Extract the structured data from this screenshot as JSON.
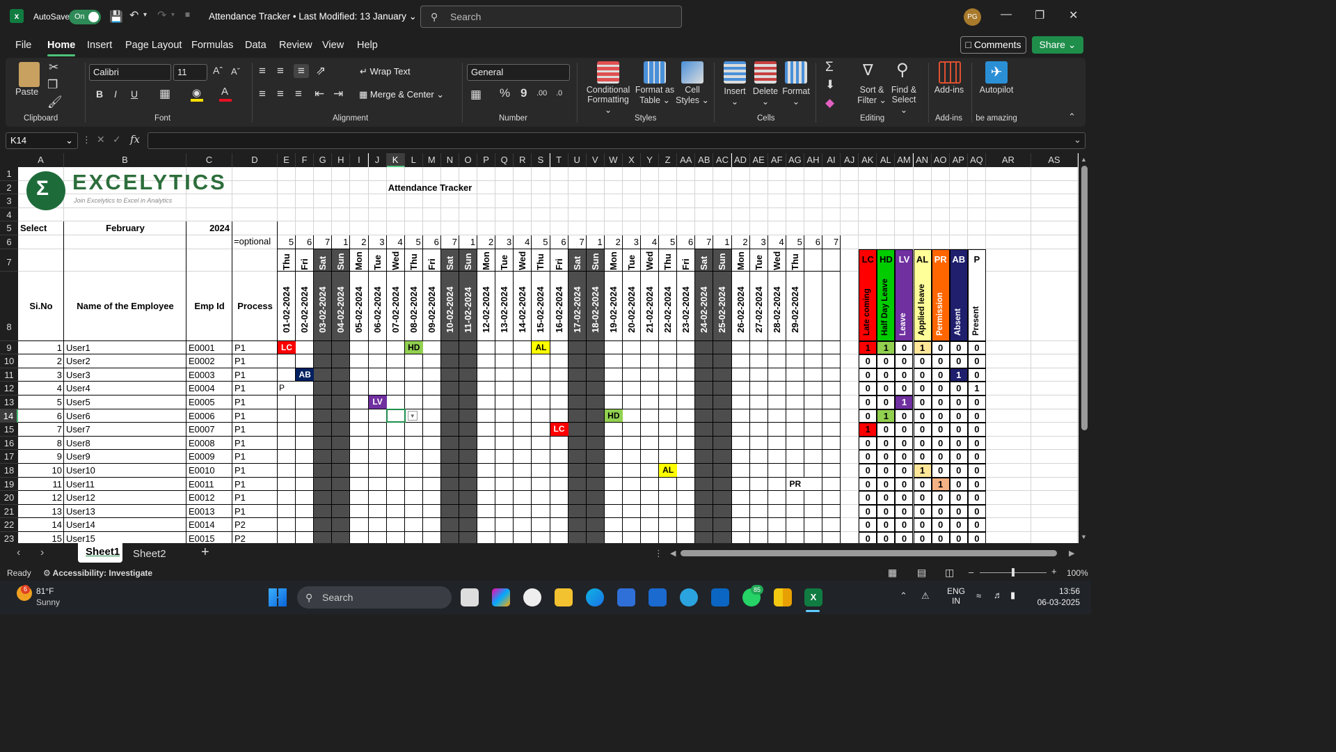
{
  "titlebar": {
    "autosave_label": "AutoSave",
    "autosave_state": "On",
    "document_title": "Attendance Tracker • Last Modified: 13 January",
    "search_placeholder": "Search",
    "user_initials": "PG"
  },
  "menu": {
    "items": [
      "File",
      "Home",
      "Insert",
      "Page Layout",
      "Formulas",
      "Data",
      "Review",
      "View",
      "Help"
    ],
    "active": "Home",
    "comments": "Comments",
    "share": "Share"
  },
  "ribbon": {
    "clipboard": {
      "paste": "Paste",
      "group": "Clipboard"
    },
    "font": {
      "name": "Calibri",
      "size": "11",
      "group": "Font",
      "bold": "B",
      "italic": "I",
      "underline": "U"
    },
    "alignment": {
      "wrap_text": "Wrap Text",
      "merge_center": "Merge & Center",
      "group": "Alignment"
    },
    "number": {
      "format": "General",
      "group": "Number",
      "percent": "%",
      "comma": "9"
    },
    "styles": {
      "conditional": "Conditional",
      "conditional2": "Formatting",
      "format_as": "Format as",
      "format_as2": "Table",
      "cell_styles": "Cell",
      "cell_styles2": "Styles",
      "group": "Styles"
    },
    "cells": {
      "insert": "Insert",
      "delete": "Delete",
      "format": "Format",
      "group": "Cells"
    },
    "editing": {
      "sort": "Sort &",
      "sort2": "Filter",
      "find": "Find &",
      "find2": "Select",
      "group": "Editing",
      "sigma": "Σ"
    },
    "addins": {
      "addins": "Add-ins",
      "group": "Add-ins"
    },
    "autopilot": {
      "label": "Autopilot",
      "group": "be amazing"
    }
  },
  "formula": {
    "namebox": "K14",
    "fx": "fx",
    "value": ""
  },
  "columns": [
    "A",
    "B",
    "C",
    "D",
    "E",
    "F",
    "G",
    "H",
    "I",
    "J",
    "K",
    "L",
    "M",
    "N",
    "O",
    "P",
    "Q",
    "R",
    "S",
    "T",
    "U",
    "V",
    "W",
    "X",
    "Y",
    "Z",
    "AA",
    "AB",
    "AC",
    "AD",
    "AE",
    "AF",
    "AG",
    "AH",
    "AI",
    "AJ",
    "AK",
    "AL",
    "AM",
    "AN",
    "AO",
    "AP",
    "AQ",
    "AR",
    "AS"
  ],
  "selected_column": "K",
  "rows": [
    "1",
    "2",
    "3",
    "4",
    "5",
    "6",
    "7",
    "8",
    "9",
    "10",
    "11",
    "12",
    "13",
    "14",
    "15",
    "16",
    "17",
    "18",
    "19",
    "20",
    "21",
    "22",
    "23"
  ],
  "selected_row": "14",
  "sheet": {
    "logo_main": "EXCELYTICS",
    "logo_tag": "Join Excelytics to Excel in Analytics",
    "title": "Attendance Tracker",
    "select_label": "Select",
    "month": "February",
    "year": "2024",
    "optional": "=optional",
    "headers": {
      "sno": "Si.No",
      "name": "Name of the Employee",
      "empid": "Emp Id",
      "process": "Process"
    },
    "daynums": [
      "5",
      "6",
      "7",
      "1",
      "2",
      "3",
      "4",
      "5",
      "6",
      "7",
      "1",
      "2",
      "3",
      "4",
      "5",
      "6",
      "7",
      "1",
      "2",
      "3",
      "4",
      "5",
      "6",
      "7",
      "1",
      "2",
      "3",
      "4",
      "5",
      "6",
      "7"
    ],
    "weekdays": [
      "Thu",
      "Fri",
      "Sat",
      "Sun",
      "Mon",
      "Tue",
      "Wed",
      "Thu",
      "Fri",
      "Sat",
      "Sun",
      "Mon",
      "Tue",
      "Wed",
      "Thu",
      "Fri",
      "Sat",
      "Sun",
      "Mon",
      "Tue",
      "Wed",
      "Thu",
      "Fri",
      "Sat",
      "Sun",
      "Mon",
      "Tue",
      "Wed",
      "Thu"
    ],
    "dates": [
      "01-02-2024",
      "02-02-2024",
      "03-02-2024",
      "04-02-2024",
      "05-02-2024",
      "06-02-2024",
      "07-02-2024",
      "08-02-2024",
      "09-02-2024",
      "10-02-2024",
      "11-02-2024",
      "12-02-2024",
      "13-02-2024",
      "14-02-2024",
      "15-02-2024",
      "16-02-2024",
      "17-02-2024",
      "18-02-2024",
      "19-02-2024",
      "20-02-2024",
      "21-02-2024",
      "22-02-2024",
      "23-02-2024",
      "24-02-2024",
      "25-02-2024",
      "26-02-2024",
      "27-02-2024",
      "28-02-2024",
      "29-02-2024"
    ],
    "summary_codes": [
      "LC",
      "HD",
      "LV",
      "AL",
      "PR",
      "AB",
      "P"
    ],
    "summary_names": [
      "Late coming",
      "Half Day Leave",
      "Leave",
      "Applied leave",
      "Permission",
      "Absent",
      "Present"
    ],
    "summary_colors": [
      "#ff0000",
      "#00cc00",
      "#7030a0",
      "#ffff99",
      "#ff6600",
      "#1f1f6e",
      "#ffffff"
    ],
    "employees": [
      {
        "no": "1",
        "name": "User1",
        "id": "E0001",
        "proc": "P1",
        "sum": [
          "1",
          "1",
          "0",
          "1",
          "0",
          "0",
          "0"
        ]
      },
      {
        "no": "2",
        "name": "User2",
        "id": "E0002",
        "proc": "P1",
        "sum": [
          "0",
          "0",
          "0",
          "0",
          "0",
          "0",
          "0"
        ]
      },
      {
        "no": "3",
        "name": "User3",
        "id": "E0003",
        "proc": "P1",
        "sum": [
          "0",
          "0",
          "0",
          "0",
          "0",
          "1",
          "0"
        ]
      },
      {
        "no": "4",
        "name": "User4",
        "id": "E0004",
        "proc": "P1",
        "sum": [
          "0",
          "0",
          "0",
          "0",
          "0",
          "0",
          "1"
        ]
      },
      {
        "no": "5",
        "name": "User5",
        "id": "E0005",
        "proc": "P1",
        "sum": [
          "0",
          "0",
          "1",
          "0",
          "0",
          "0",
          "0"
        ]
      },
      {
        "no": "6",
        "name": "User6",
        "id": "E0006",
        "proc": "P1",
        "sum": [
          "0",
          "1",
          "0",
          "0",
          "0",
          "0",
          "0"
        ]
      },
      {
        "no": "7",
        "name": "User7",
        "id": "E0007",
        "proc": "P1",
        "sum": [
          "1",
          "0",
          "0",
          "0",
          "0",
          "0",
          "0"
        ]
      },
      {
        "no": "8",
        "name": "User8",
        "id": "E0008",
        "proc": "P1",
        "sum": [
          "0",
          "0",
          "0",
          "0",
          "0",
          "0",
          "0"
        ]
      },
      {
        "no": "9",
        "name": "User9",
        "id": "E0009",
        "proc": "P1",
        "sum": [
          "0",
          "0",
          "0",
          "0",
          "0",
          "0",
          "0"
        ]
      },
      {
        "no": "10",
        "name": "User10",
        "id": "E0010",
        "proc": "P1",
        "sum": [
          "0",
          "0",
          "0",
          "1",
          "0",
          "0",
          "0"
        ]
      },
      {
        "no": "11",
        "name": "User11",
        "id": "E0011",
        "proc": "P1",
        "sum": [
          "0",
          "0",
          "0",
          "0",
          "1",
          "0",
          "0"
        ]
      },
      {
        "no": "12",
        "name": "User12",
        "id": "E0012",
        "proc": "P1",
        "sum": [
          "0",
          "0",
          "0",
          "0",
          "0",
          "0",
          "0"
        ]
      },
      {
        "no": "13",
        "name": "User13",
        "id": "E0013",
        "proc": "P1",
        "sum": [
          "0",
          "0",
          "0",
          "0",
          "0",
          "0",
          "0"
        ]
      },
      {
        "no": "14",
        "name": "User14",
        "id": "E0014",
        "proc": "P2",
        "sum": [
          "0",
          "0",
          "0",
          "0",
          "0",
          "0",
          "0"
        ]
      },
      {
        "no": "15",
        "name": "User15",
        "id": "E0015",
        "proc": "P2",
        "sum": [
          "0",
          "0",
          "0",
          "0",
          "0",
          "0",
          "0"
        ]
      }
    ],
    "marks": [
      {
        "emp": 0,
        "day": 0,
        "code": "LC"
      },
      {
        "emp": 0,
        "day": 7,
        "code": "HD"
      },
      {
        "emp": 0,
        "day": 14,
        "code": "AL"
      },
      {
        "emp": 2,
        "day": 1,
        "code": "AB"
      },
      {
        "emp": 3,
        "day": 0,
        "code": "P"
      },
      {
        "emp": 4,
        "day": 5,
        "code": "LV"
      },
      {
        "emp": 5,
        "day": 18,
        "code": "HD"
      },
      {
        "emp": 6,
        "day": 15,
        "code": "LC"
      },
      {
        "emp": 9,
        "day": 21,
        "code": "AL"
      },
      {
        "emp": 10,
        "day": 28,
        "code": "PR"
      }
    ]
  },
  "tabs": {
    "sheets": [
      "Sheet1",
      "Sheet2"
    ],
    "active": "Sheet1"
  },
  "status": {
    "ready": "Ready",
    "accessibility": "Accessibility: Investigate",
    "zoom": "100%"
  },
  "taskbar": {
    "temp": "81°F",
    "weather": "Sunny",
    "weather_badge": "6",
    "search": "Search",
    "lang1": "ENG",
    "lang2": "IN",
    "time": "13:56",
    "date": "06-03-2025",
    "whatsapp_badge": "85"
  }
}
